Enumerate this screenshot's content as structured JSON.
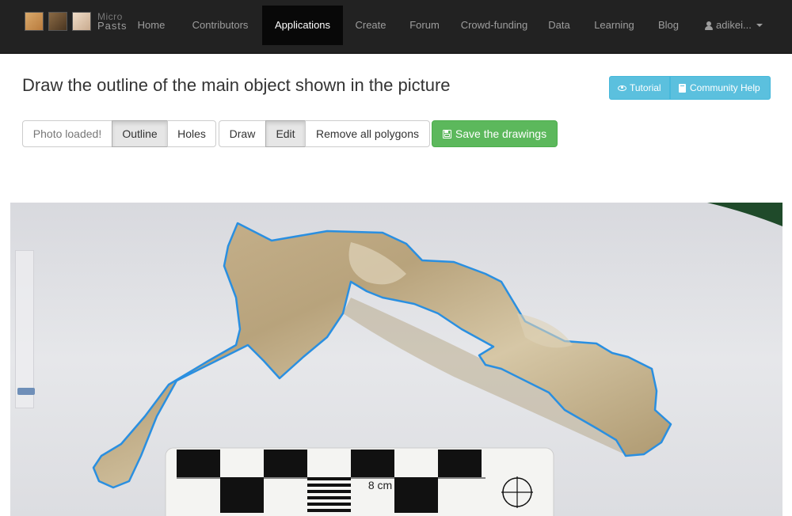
{
  "brand": {
    "line1": "Micro",
    "line2": "Pasts"
  },
  "nav": {
    "home": "Home",
    "contributors": "Contributors",
    "applications": "Applications",
    "create": "Create",
    "forum": "Forum",
    "crowdfunding": "Crowd-funding",
    "data": "Data",
    "learning": "Learning",
    "blog": "Blog",
    "active": "Applications"
  },
  "user": {
    "name": "adikei..."
  },
  "page": {
    "title": "Draw the outline of the main object shown in the picture"
  },
  "help": {
    "tutorial": "Tutorial",
    "community_help": "Community Help"
  },
  "toolbar": {
    "status": "Photo loaded!",
    "outline": "Outline",
    "holes": "Holes",
    "draw": "Draw",
    "edit": "Edit",
    "remove_all": "Remove all polygons",
    "save": "Save the drawings"
  },
  "photo": {
    "scale_label": "8 cm"
  },
  "colors": {
    "navbar": "#222222",
    "info": "#5bc0de",
    "success": "#5cb85c",
    "outline_stroke": "#2a8fe0"
  },
  "icons": [
    "user-icon",
    "caret-down-icon",
    "eye-icon",
    "book-icon",
    "floppy-disk-icon"
  ]
}
